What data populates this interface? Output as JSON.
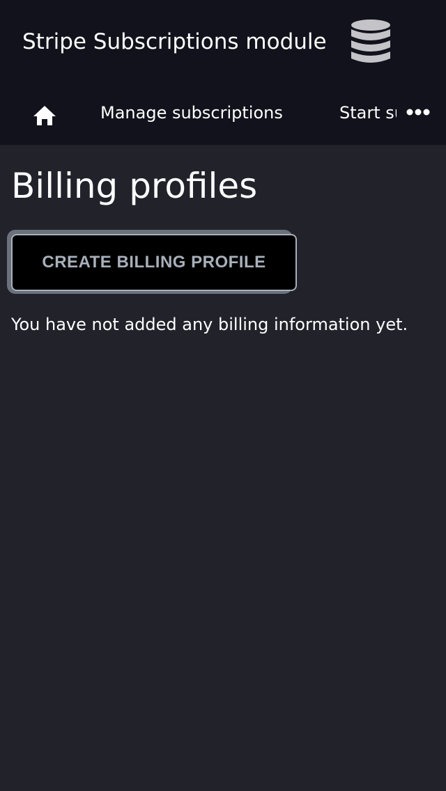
{
  "header": {
    "title": "Stripe Subscriptions module",
    "icon": "database-icon"
  },
  "nav": {
    "home_icon": "home-icon",
    "items": [
      {
        "label": "Manage subscriptions"
      },
      {
        "label": "Start subscription"
      }
    ],
    "more_icon": "more-horizontal-icon"
  },
  "main": {
    "title": "Billing profiles",
    "create_button": "CREATE BILLING PROFILE",
    "empty_message": "You have not added any billing information yet."
  },
  "colors": {
    "header_bg": "#12121c",
    "body_bg": "#22222b",
    "button_text": "#a8b0ba",
    "icon": "#c4c4c8"
  }
}
